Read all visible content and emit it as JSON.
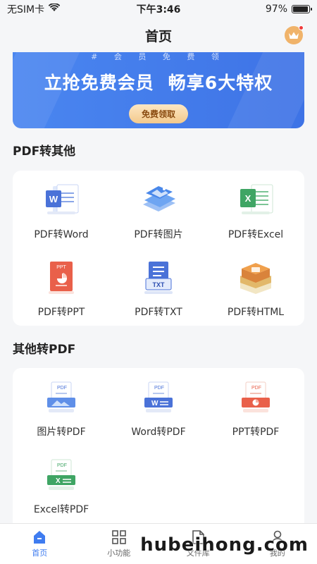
{
  "status": {
    "carrier": "无SIM卡",
    "time": "下午3:46",
    "battery": "97%",
    "battery_level": 0.97
  },
  "nav": {
    "title": "首页"
  },
  "banner": {
    "subtitle": "#  会  员  免  费  领",
    "title_left": "立抢免费会员",
    "title_right": "畅享6大特权",
    "button": "免费领取"
  },
  "sections": {
    "pdf_to_other": {
      "title": "PDF转其他",
      "items": [
        {
          "label": "PDF转Word",
          "icon": "word-doc-icon"
        },
        {
          "label": "PDF转图片",
          "icon": "image-icon"
        },
        {
          "label": "PDF转Excel",
          "icon": "excel-doc-icon"
        },
        {
          "label": "PDF转PPT",
          "icon": "ppt-doc-icon"
        },
        {
          "label": "PDF转TXT",
          "icon": "txt-doc-icon"
        },
        {
          "label": "PDF转HTML",
          "icon": "html-doc-icon"
        }
      ]
    },
    "other_to_pdf": {
      "title": "其他转PDF",
      "items": [
        {
          "label": "图片转PDF",
          "icon": "image-to-pdf-icon"
        },
        {
          "label": "Word转PDF",
          "icon": "word-to-pdf-icon"
        },
        {
          "label": "PPT转PDF",
          "icon": "ppt-to-pdf-icon"
        },
        {
          "label": "Excel转PDF",
          "icon": "excel-to-pdf-icon"
        }
      ]
    }
  },
  "tabbar": [
    {
      "label": "首页",
      "icon": "home-icon",
      "active": true
    },
    {
      "label": "小功能",
      "icon": "grid-icon",
      "active": false
    },
    {
      "label": "文件库",
      "icon": "folder-icon",
      "active": false
    },
    {
      "label": "我的",
      "icon": "user-icon",
      "active": false
    }
  ],
  "watermark": "hubeihong.com",
  "colors": {
    "accent": "#3f7cf0",
    "banner": "#4a86f0",
    "word": "#4a72d8",
    "excel": "#3fa564",
    "ppt": "#e9604a"
  }
}
